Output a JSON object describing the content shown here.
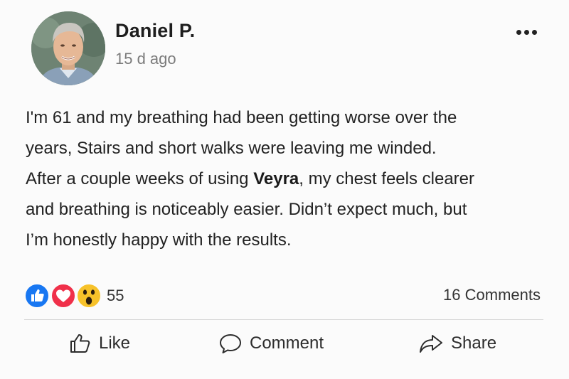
{
  "post": {
    "author_name": "Daniel P.",
    "time": "15 d ago",
    "more_label": "More options",
    "body": {
      "line1": "I'm 61 and my breathing had been getting worse over the",
      "line2": "years, Stairs and short walks were leaving me winded.",
      "line3_before": "After a couple weeks of using ",
      "line3_bold": "Veyra",
      "line3_after": ", my chest feels clearer",
      "line4": "and breathing is noticeably easier. Didn’t expect much, but",
      "line5": "I’m honestly happy with the results."
    }
  },
  "stats": {
    "reaction_icons": [
      "like-reaction-icon",
      "love-reaction-icon",
      "wow-reaction-icon"
    ],
    "reaction_count": "55",
    "comments": "16 Comments"
  },
  "actions": {
    "like": "Like",
    "comment": "Comment",
    "share": "Share"
  },
  "colors": {
    "like_blue": "#1877f2",
    "love_red": "#f0304a",
    "wow_yellow": "#f7c22a",
    "text": "#1c1c1c",
    "muted": "#7b7b7b",
    "background": "#fbfbfb"
  }
}
